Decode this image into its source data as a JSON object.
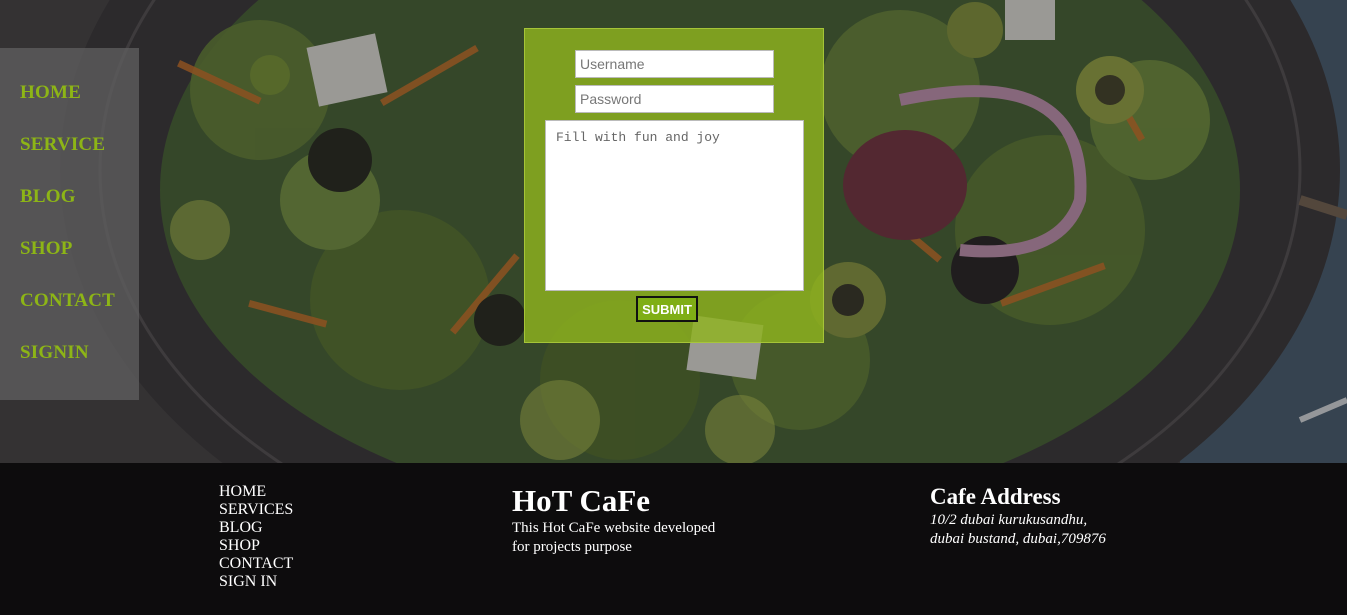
{
  "nav": {
    "items": [
      {
        "label": "HOME"
      },
      {
        "label": "SERVICE"
      },
      {
        "label": "BLOG"
      },
      {
        "label": "SHOP"
      },
      {
        "label": "CONTACT"
      },
      {
        "label": "SIGNIN"
      }
    ]
  },
  "form": {
    "username_placeholder": "Username",
    "password_placeholder": "Password",
    "message_placeholder": "Fill with fun and joy",
    "submit_label": "SUBMIT"
  },
  "footer": {
    "links": [
      {
        "label": "HOME"
      },
      {
        "label": "SERVICES"
      },
      {
        "label": "BLOG"
      },
      {
        "label": "SHOP"
      },
      {
        "label": "CONTACT"
      },
      {
        "label": "SIGN IN"
      }
    ],
    "brand_title": "HoT CaFe",
    "brand_description": "This Hot CaFe website developed for projects purpose",
    "address_title": "Cafe Address",
    "address_line1": "10/2 dubai kurukusandhu,",
    "address_line2": "dubai bustand, dubai,709876"
  },
  "colors": {
    "accent_green": "#8db516",
    "form_panel": "#8fb31e",
    "submit_button": "#7fae15",
    "footer_bg": "#0d0c0d",
    "nav_bg": "#5f5f5f"
  },
  "icons": {
    "background": "salad-plate-image"
  }
}
